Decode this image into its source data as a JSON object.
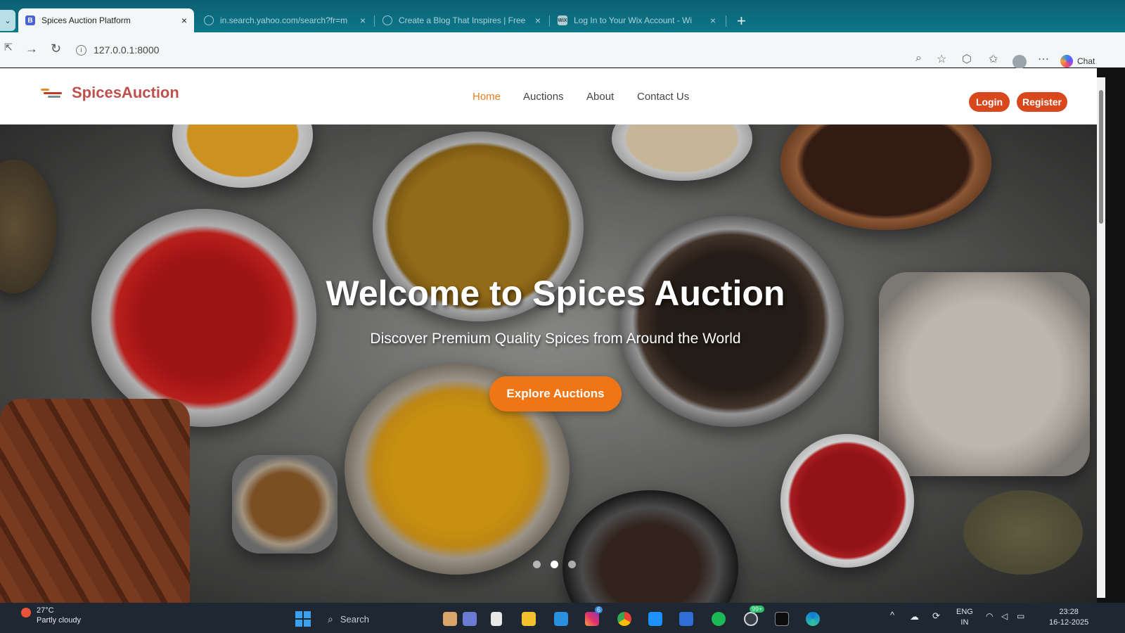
{
  "browser": {
    "tabs": [
      {
        "title": "Spices Auction Platform",
        "favicon": "B",
        "active": true
      },
      {
        "title": "in.search.yahoo.com/search?fr=m",
        "favicon": "globe-icon",
        "active": false
      },
      {
        "title": "Create a Blog That Inspires | Free",
        "favicon": "globe-icon",
        "active": false
      },
      {
        "title": "Log In to Your Wix Account - Wi",
        "favicon": "WiX",
        "active": false
      }
    ],
    "close_glyph": "×",
    "new_tab_glyph": "+",
    "url": "127.0.0.1:8000",
    "chat_label": "Chat"
  },
  "site": {
    "brand": "SpicesAuction",
    "nav": [
      "Home",
      "Auctions",
      "About",
      "Contact Us"
    ],
    "login_label": "Login",
    "register_label": "Register",
    "hero": {
      "title": "Welcome to Spices Auction",
      "subtitle": "Discover Premium Quality Spices from Around the World",
      "cta": "Explore Auctions",
      "slides_total": 3,
      "active_slide": 2
    },
    "colors": {
      "accent": "#f07515",
      "brand": "#c0504d",
      "button": "#d9481c"
    }
  },
  "taskbar": {
    "weather_temp": "27°C",
    "weather_desc": "Partly cloudy",
    "search_placeholder": "Search",
    "badge_instagram": "6",
    "badge_whatsapp": "99+",
    "lang_top": "ENG",
    "lang_bottom": "IN",
    "time": "23:28",
    "date": "16-12-2025"
  }
}
